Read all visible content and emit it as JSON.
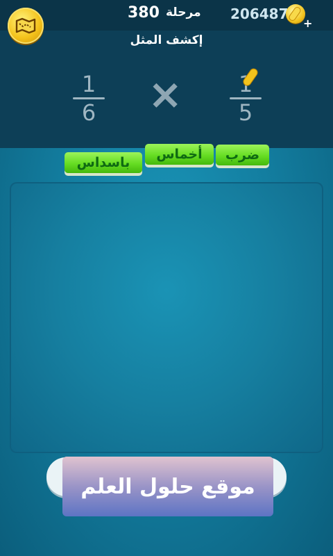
{
  "header": {
    "level_label": "مرحلة",
    "level_number": "380",
    "coins": "206487",
    "coin_plus": "+",
    "hint_icon": "map-icon",
    "coin_icon": "coin-icon"
  },
  "puzzle": {
    "title": "إكشف المثل",
    "left_fraction": {
      "numerator": "1",
      "denominator": "6"
    },
    "operator": "×",
    "right_fraction": {
      "numerator": "1",
      "denominator": "5"
    }
  },
  "word_tiles": [
    {
      "label": "باسداس"
    },
    {
      "label": "أخماس"
    },
    {
      "label": "ضرب"
    }
  ],
  "watermark": {
    "text": "موقع حلول العلم"
  }
}
